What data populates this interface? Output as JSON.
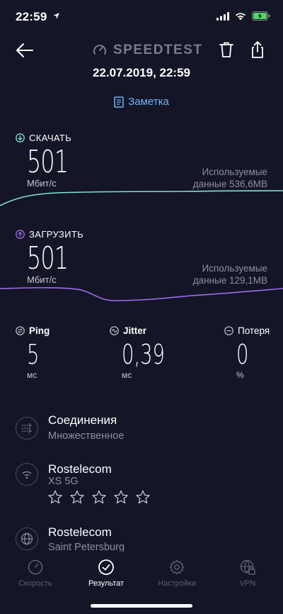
{
  "status": {
    "time": "22:59"
  },
  "header": {
    "app_name": "SPEEDTEST",
    "date": "22.07.2019, 22:59",
    "note_label": "Заметка"
  },
  "download": {
    "label": "СКАЧАТЬ",
    "value": "501",
    "unit": "Мбит/с",
    "used_label": "Используемые",
    "used_value": "данные 536,6MB",
    "color": "#7fe0d6"
  },
  "upload": {
    "label": "ЗАГРУЗИТЬ",
    "value": "501",
    "unit": "Мбит/с",
    "used_label": "Используемые",
    "used_value": "данные 129,1MB",
    "color": "#a06cf0"
  },
  "ping": {
    "label": "Ping",
    "value": "5",
    "unit": "мс"
  },
  "jitter": {
    "label": "Jitter",
    "value": "0,39",
    "unit": "мс"
  },
  "loss": {
    "label": "Потеря",
    "value": "0",
    "unit": "%"
  },
  "info": [
    {
      "title": "Соединения",
      "sub": "Множественное",
      "icon": "connections-icon"
    },
    {
      "title": "Rostelecom",
      "sub": "XS  5G",
      "icon": "wifi-icon",
      "stars": 5,
      "rating": 0
    },
    {
      "title": "Rostelecom",
      "sub": "Saint Petersburg",
      "icon": "globe-icon"
    }
  ],
  "tabs": [
    {
      "label": "Скорость",
      "icon": "gauge-icon",
      "active": false
    },
    {
      "label": "Результат",
      "icon": "check-circle-icon",
      "active": true
    },
    {
      "label": "Настройки",
      "icon": "gear-icon",
      "active": false
    },
    {
      "label": "VPN",
      "icon": "vpn-lock-icon",
      "active": false
    }
  ],
  "colors": {
    "background": "#141526",
    "accent_blue": "#6fb6f4"
  }
}
